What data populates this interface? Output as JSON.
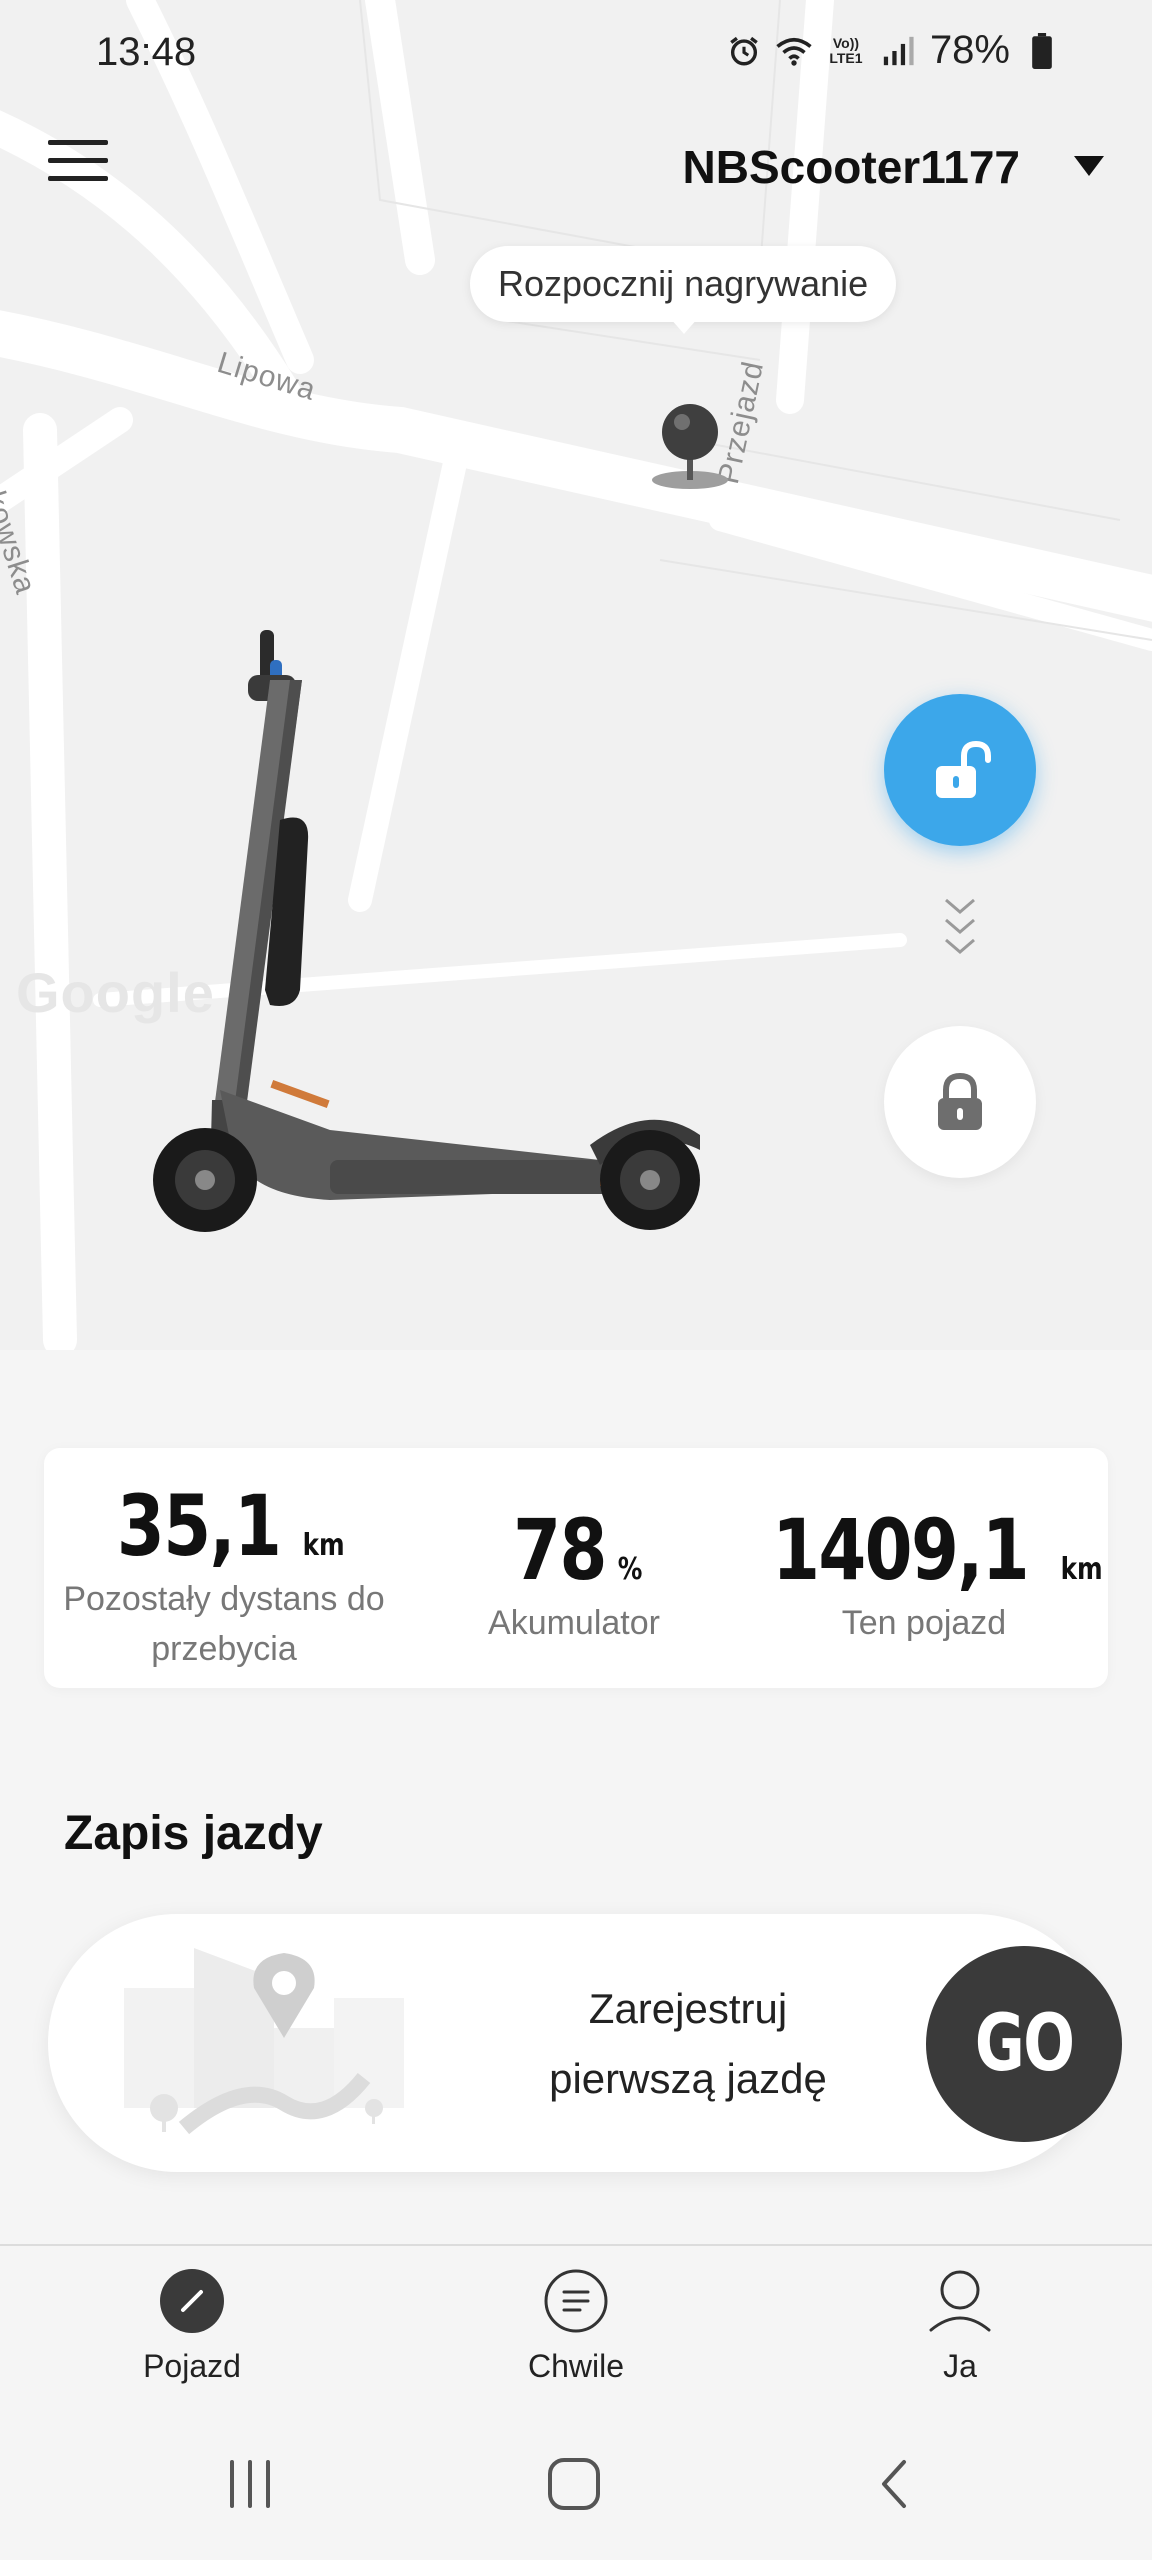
{
  "status_bar": {
    "time": "13:48",
    "network": "Vo)) LTE1",
    "battery": "78%"
  },
  "header": {
    "device_name": "NBScooter1177"
  },
  "map": {
    "tooltip": "Rozpocznij nagrywanie",
    "streets": [
      "Lipowa",
      "Przejazd",
      "Krakowska"
    ],
    "watermark": "Google"
  },
  "colors": {
    "unlock_accent": "#3ca7ea",
    "go_button": "#3a3a3a"
  },
  "icons": {
    "menu": "menu-icon",
    "unlock": "unlock-icon",
    "lock": "lock-icon",
    "expand": "chevron-down-icon"
  },
  "stats": {
    "range": {
      "value": "35,1",
      "unit": "km",
      "label": "Pozostały dystans do przebycia"
    },
    "battery": {
      "value": "78",
      "unit": "%",
      "label": "Akumulator"
    },
    "odometer": {
      "value": "1409,1",
      "unit": "km",
      "label": "Ten pojazd"
    }
  },
  "ride": {
    "section_title": "Zapis jazdy",
    "prompt_line1": "Zarejestruj",
    "prompt_line2": "pierwszą jazdę",
    "go_label": "GO"
  },
  "bottom_nav": {
    "items": [
      {
        "label": "Pojazd",
        "icon": "scooter-tab-icon",
        "active": true
      },
      {
        "label": "Chwile",
        "icon": "moments-tab-icon",
        "active": false
      },
      {
        "label": "Ja",
        "icon": "profile-tab-icon",
        "active": false
      }
    ]
  }
}
